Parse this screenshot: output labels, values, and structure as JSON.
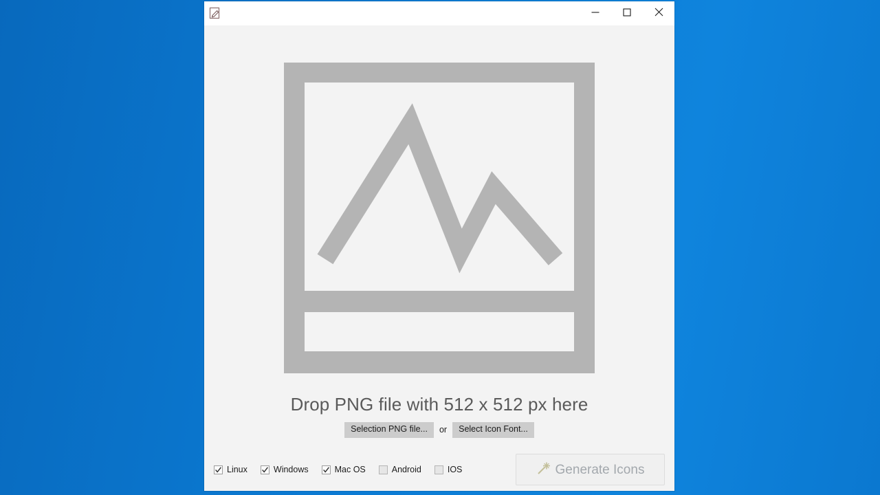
{
  "desktop": {
    "background_color": "#0b78d0"
  },
  "window": {
    "title": "",
    "icon": "pencil-edit-icon",
    "background_color": "#f3f3f3",
    "titlebar_color": "#ffffff",
    "controls": {
      "minimize_label": "—",
      "maximize_label": "☐",
      "close_label": "✕"
    }
  },
  "drop_area": {
    "placeholder_icon": "image-placeholder-icon",
    "placeholder_color": "#b4b4b4",
    "hint_text": "Drop PNG file with 512 x 512 px here",
    "select_png_label": "Selection PNG file...",
    "or_label": "or",
    "select_font_label": "Select Icon Font..."
  },
  "bottom_bar": {
    "platforms": [
      {
        "label": "Linux",
        "checked": true
      },
      {
        "label": "Windows",
        "checked": true
      },
      {
        "label": "Mac OS",
        "checked": true
      },
      {
        "label": "Android",
        "checked": false
      },
      {
        "label": "IOS",
        "checked": false
      }
    ],
    "generate_button": {
      "label": "Generate Icons",
      "icon": "magic-wand-icon",
      "enabled": false
    }
  }
}
